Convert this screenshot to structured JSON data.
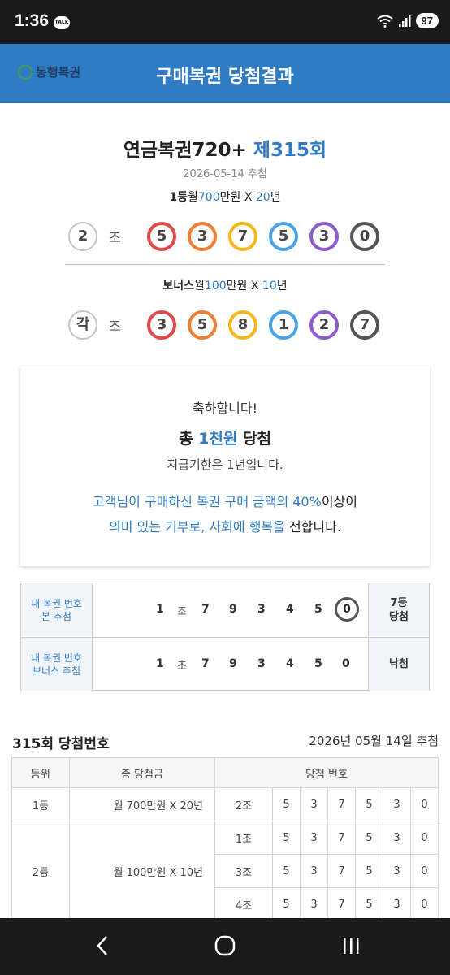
{
  "status": {
    "time": "1:36",
    "talk": "TALK",
    "battery": "97"
  },
  "header": {
    "logo_text": "동행복권",
    "title": "구매복권 당첨결과"
  },
  "result": {
    "game": "연금복권720+",
    "round": "제315회",
    "date": "2026-05-14 추첨",
    "first": {
      "rank": "1등",
      "w1": "월",
      "amount": "700",
      "unit": "만원 X",
      "years": "20",
      "yunit": "년",
      "group": "2",
      "jo": "조",
      "digits": [
        "5",
        "3",
        "7",
        "5",
        "3",
        "0"
      ]
    },
    "bonus": {
      "rank": "보너스",
      "w1": "월",
      "amount": "100",
      "unit": "만원 X",
      "years": "10",
      "yunit": "년",
      "group": "각",
      "jo": "조",
      "digits": [
        "3",
        "5",
        "8",
        "1",
        "2",
        "7"
      ]
    },
    "ball_colors": [
      "#e34848",
      "#f07d34",
      "#f4b81e",
      "#4aa3e6",
      "#8b5bd0",
      "#555555"
    ]
  },
  "congrats": {
    "line1": "축하합니다!",
    "total_pre": "총 ",
    "total_amount": "1천원",
    "total_post": " 당첨",
    "deadline": "지급기한은 1년입니다.",
    "msg1_a": "고객님이 구매하신 복권 구매 금액의 40%",
    "msg1_b": "이상이",
    "msg2_a": "의미 있는 기부로, 사회에 행복을",
    "msg2_b": " 전합니다."
  },
  "my_ticket": {
    "rows": [
      {
        "label1": "내 복권 번호",
        "label2": "본 추첨",
        "group": "1",
        "jo": "조",
        "digits": [
          "7",
          "9",
          "3",
          "4",
          "5",
          "0"
        ],
        "result1": "7등",
        "result2": "당첨"
      },
      {
        "label1": "내 복권 번호",
        "label2": "보너스 추첨",
        "group": "1",
        "jo": "조",
        "digits": [
          "7",
          "9",
          "3",
          "4",
          "5",
          "0"
        ],
        "result1": "낙첨",
        "result2": ""
      }
    ]
  },
  "winning": {
    "title": "315회 당첨번호",
    "date": "2026년 05월 14일 추첨",
    "headers": [
      "등위",
      "총 당첨금",
      "당첨 번호"
    ],
    "rank1": {
      "rank": "1등",
      "prize": "월 700만원 X 20년",
      "group": "2조",
      "digits": [
        "5",
        "3",
        "7",
        "5",
        "3",
        "0"
      ]
    },
    "rank2": {
      "rank": "2등",
      "prize": "월 100만원 X 10년",
      "rows": [
        {
          "group": "1조",
          "digits": [
            "5",
            "3",
            "7",
            "5",
            "3",
            "0"
          ]
        },
        {
          "group": "3조",
          "digits": [
            "5",
            "3",
            "7",
            "5",
            "3",
            "0"
          ]
        },
        {
          "group": "4조",
          "digits": [
            "5",
            "3",
            "7",
            "5",
            "3",
            "0"
          ]
        }
      ]
    }
  },
  "nav": {
    "back": "‹",
    "home": "○",
    "recents": "|||"
  }
}
